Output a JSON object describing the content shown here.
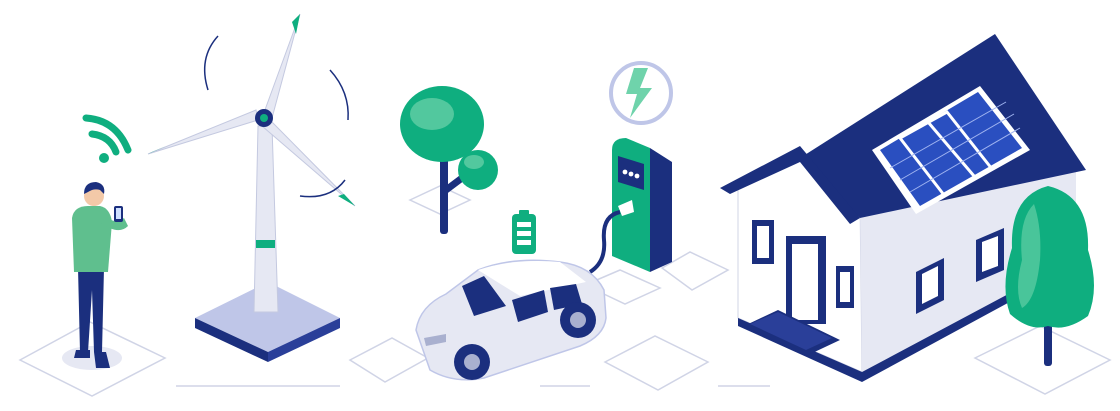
{
  "colors": {
    "navy": "#1b2f7e",
    "green": "#0fae7f",
    "light_green": "#6fd3ab",
    "pale_green": "#8fe0bd",
    "mint": "#a6dfb9",
    "lavender": "#e6e8f3",
    "light_blue": "#bfc6e8",
    "grey_blue": "#a9b0cf",
    "outline": "#d0d4e6",
    "white": "#ffffff"
  },
  "icons": {
    "wifi": "wifi-icon",
    "lightning": "lightning-icon",
    "battery": "battery-icon",
    "solar_panel": "solar-panel-icon"
  }
}
